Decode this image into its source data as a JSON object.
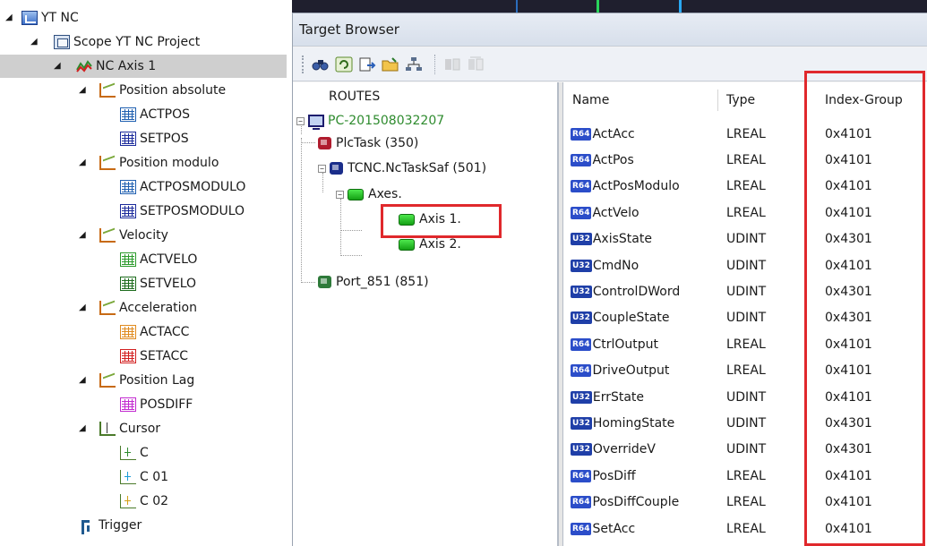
{
  "left_tree": {
    "items": [
      {
        "label": "YT NC",
        "icon": "nc-icon"
      },
      {
        "label": "Scope YT NC Project",
        "icon": "scope-project-icon"
      },
      {
        "label": "NC Axis 1",
        "icon": "axis-icon"
      },
      {
        "label": "Position absolute",
        "icon": "chart-icon"
      },
      {
        "label": "ACTPOS",
        "icon": "channel-icon",
        "color": "#1f5fb0"
      },
      {
        "label": "SETPOS",
        "icon": "channel-icon",
        "color": "#1b2a9b"
      },
      {
        "label": "Position modulo",
        "icon": "chart-icon"
      },
      {
        "label": "ACTPOSMODULO",
        "icon": "channel-icon",
        "color": "#1f5fb0"
      },
      {
        "label": "SETPOSMODULO",
        "icon": "channel-icon",
        "color": "#1b2a9b"
      },
      {
        "label": "Velocity",
        "icon": "chart-icon"
      },
      {
        "label": "ACTVELO",
        "icon": "channel-icon",
        "color": "#2b9a2b"
      },
      {
        "label": "SETVELO",
        "icon": "channel-icon",
        "color": "#1c6b1c"
      },
      {
        "label": "Acceleration",
        "icon": "chart-icon"
      },
      {
        "label": "ACTACC",
        "icon": "channel-icon",
        "color": "#e08a1e"
      },
      {
        "label": "SETACC",
        "icon": "channel-icon",
        "color": "#d21f1f"
      },
      {
        "label": "Position Lag",
        "icon": "chart-icon"
      },
      {
        "label": "POSDIFF",
        "icon": "channel-icon",
        "color": "#c22bd0"
      },
      {
        "label": "Cursor",
        "icon": "cursor-icon"
      },
      {
        "label": "C",
        "icon": "cursor-marker-icon",
        "color": "#2e8b2e"
      },
      {
        "label": "C 01",
        "icon": "cursor-marker-icon",
        "color": "#1a9bd6"
      },
      {
        "label": "C 02",
        "icon": "cursor-marker-icon",
        "color": "#d4a017"
      },
      {
        "label": "Trigger",
        "icon": "trigger-icon"
      }
    ]
  },
  "dialog": {
    "title": "Target Browser",
    "routes": {
      "title": "ROUTES",
      "nodes": [
        {
          "label": "PC-201508032207",
          "color": "#2e8b2e",
          "icon": "pc-icon"
        },
        {
          "label": "PlcTask (350)",
          "icon": "task-icon",
          "icon_color": "#b01c2e"
        },
        {
          "label": "TCNC.NcTaskSaf (501)",
          "icon": "task-icon",
          "icon_color": "#1a2d8a"
        },
        {
          "label": "Axes.",
          "icon": "axes-folder-icon"
        },
        {
          "label": "Axis 1.",
          "icon": "axis-node-icon"
        },
        {
          "label": "Axis 2.",
          "icon": "axis-node-icon"
        },
        {
          "label": "Port_851 (851)",
          "icon": "port-icon",
          "icon_color": "#2e7a3a"
        }
      ]
    },
    "table": {
      "columns": [
        "Name",
        "Type",
        "Index-Group"
      ],
      "rows": [
        {
          "badge": "R64",
          "name": "ActAcc",
          "type": "LREAL",
          "group": "0x4101"
        },
        {
          "badge": "R64",
          "name": "ActPos",
          "type": "LREAL",
          "group": "0x4101"
        },
        {
          "badge": "R64",
          "name": "ActPosModulo",
          "type": "LREAL",
          "group": "0x4101"
        },
        {
          "badge": "R64",
          "name": "ActVelo",
          "type": "LREAL",
          "group": "0x4101"
        },
        {
          "badge": "U32",
          "name": "AxisState",
          "type": "UDINT",
          "group": "0x4301"
        },
        {
          "badge": "U32",
          "name": "CmdNo",
          "type": "UDINT",
          "group": "0x4101"
        },
        {
          "badge": "U32",
          "name": "ControlDWord",
          "type": "UDINT",
          "group": "0x4301"
        },
        {
          "badge": "U32",
          "name": "CoupleState",
          "type": "UDINT",
          "group": "0x4301"
        },
        {
          "badge": "R64",
          "name": "CtrlOutput",
          "type": "LREAL",
          "group": "0x4101"
        },
        {
          "badge": "R64",
          "name": "DriveOutput",
          "type": "LREAL",
          "group": "0x4101"
        },
        {
          "badge": "U32",
          "name": "ErrState",
          "type": "UDINT",
          "group": "0x4101"
        },
        {
          "badge": "U32",
          "name": "HomingState",
          "type": "UDINT",
          "group": "0x4301"
        },
        {
          "badge": "U32",
          "name": "OverrideV",
          "type": "UDINT",
          "group": "0x4301"
        },
        {
          "badge": "R64",
          "name": "PosDiff",
          "type": "LREAL",
          "group": "0x4101"
        },
        {
          "badge": "R64",
          "name": "PosDiffCouple",
          "type": "LREAL",
          "group": "0x4101"
        },
        {
          "badge": "R64",
          "name": "SetAcc",
          "type": "LREAL",
          "group": "0x4101"
        }
      ]
    },
    "badge_colors": {
      "R64": "#2b4dc9",
      "U32": "#1f3fa8"
    },
    "highlight_color": "#e0282c"
  }
}
